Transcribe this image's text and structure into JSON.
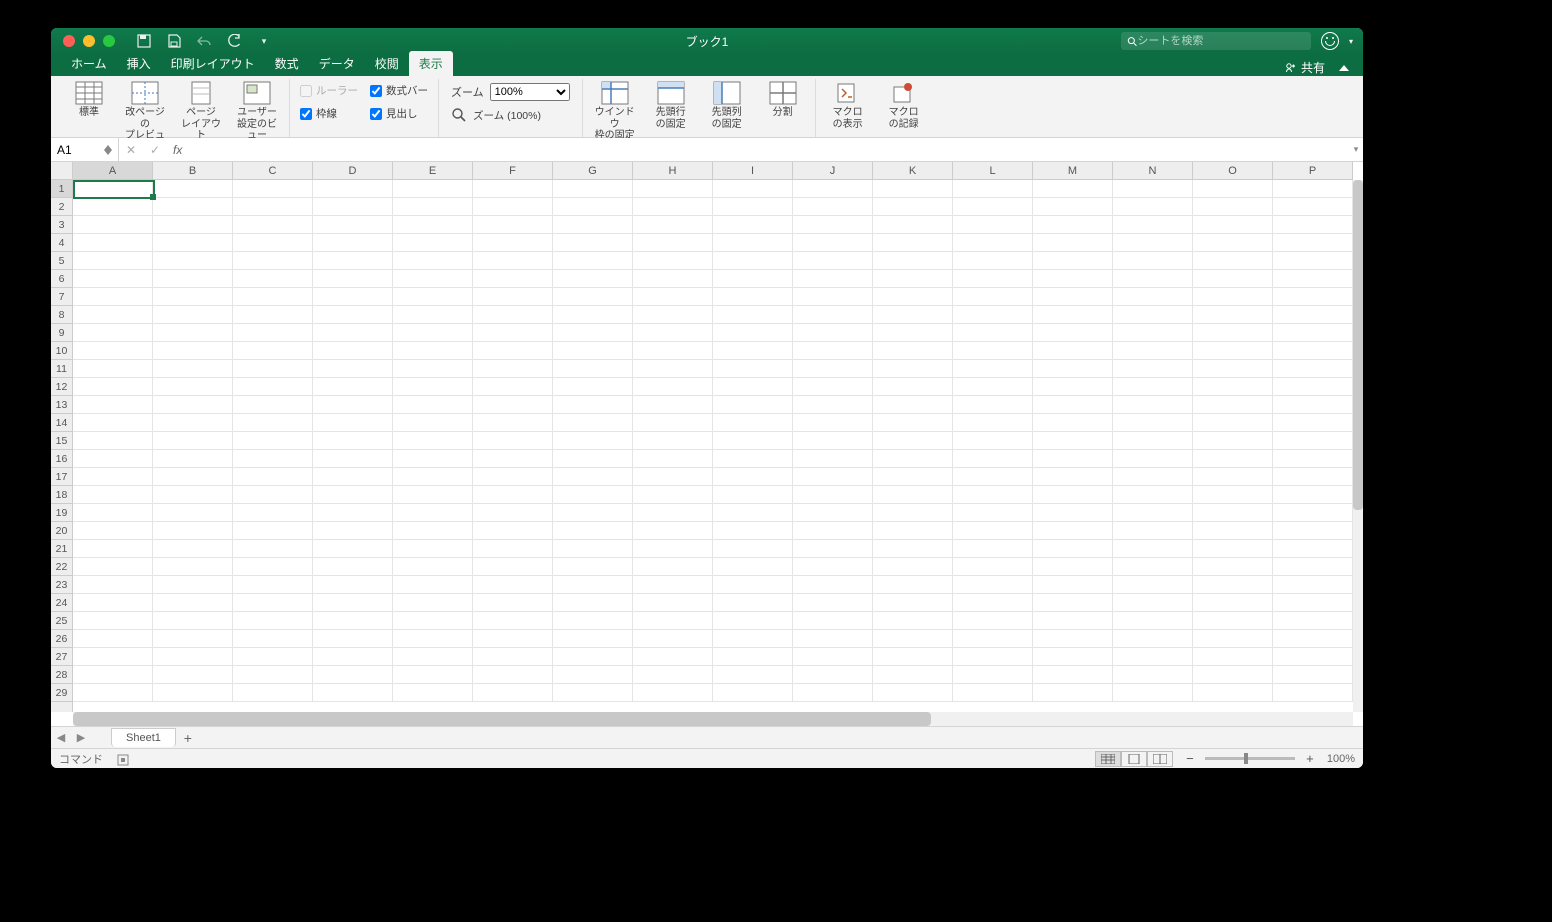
{
  "title": "ブック1",
  "search_placeholder": "シートを検索",
  "tabs": [
    "ホーム",
    "挿入",
    "印刷レイアウト",
    "数式",
    "データ",
    "校閲",
    "表示"
  ],
  "active_tab": "表示",
  "share_label": "共有",
  "ribbon": {
    "views": {
      "normal": "標準",
      "page_break": "改ページの\nプレビュー",
      "page_layout": "ページ\nレイアウト",
      "custom": "ユーザー\n設定のビュー"
    },
    "checks": {
      "ruler": "ルーラー",
      "formula_bar": "数式バー",
      "gridlines": "枠線",
      "headings": "見出し"
    },
    "zoom_label": "ズーム",
    "zoom_value": "100%",
    "zoom_100": "ズーム (100%)",
    "window": {
      "freeze": "ウインドウ\n枠の固定",
      "freeze_row": "先頭行\nの固定",
      "freeze_col": "先頭列\nの固定",
      "split": "分割"
    },
    "macros": {
      "view": "マクロ\nの表示",
      "record": "マクロ\nの記録"
    }
  },
  "namebox": "A1",
  "columns": [
    "A",
    "B",
    "C",
    "D",
    "E",
    "F",
    "G",
    "H",
    "I",
    "J",
    "K",
    "L",
    "M",
    "N",
    "O",
    "P"
  ],
  "row_count": 29,
  "sheet_name": "Sheet1",
  "status": {
    "command": "コマンド",
    "zoom": "100%"
  }
}
